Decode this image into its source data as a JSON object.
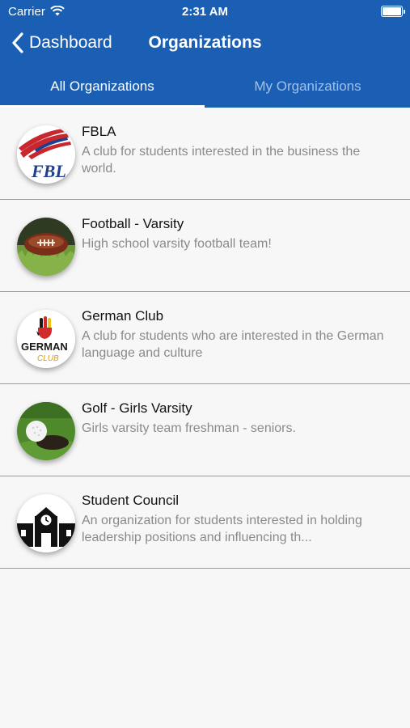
{
  "status_bar": {
    "carrier": "Carrier",
    "time": "2:31 AM"
  },
  "nav": {
    "back_label": "Dashboard",
    "title": "Organizations"
  },
  "tabs": [
    {
      "label": "All Organizations",
      "active": true
    },
    {
      "label": "My Organizations",
      "active": false
    }
  ],
  "organizations": [
    {
      "name": "FBLA",
      "description": "A club for students interested in the business the world.",
      "icon": "fbla-logo"
    },
    {
      "name": "Football - Varsity",
      "description": "High school varsity football team!",
      "icon": "football-photo"
    },
    {
      "name": "German Club",
      "description": "A club for students who are interested in the German language and culture",
      "icon": "german-club-logo"
    },
    {
      "name": "Golf - Girls Varsity",
      "description": "Girls varsity team freshman - seniors.",
      "icon": "golf-ball-photo"
    },
    {
      "name": "Student Council",
      "description": "An organization for students interested in holding leadership positions and influencing th...",
      "icon": "school-building-icon"
    }
  ],
  "colors": {
    "header": "#1b5fb4",
    "background": "#f7f7f7",
    "inactive_tab": "#9fc0ea"
  },
  "logo_text": {
    "fbla": "FBL",
    "german": "GERMAN",
    "club": "CLUB"
  }
}
